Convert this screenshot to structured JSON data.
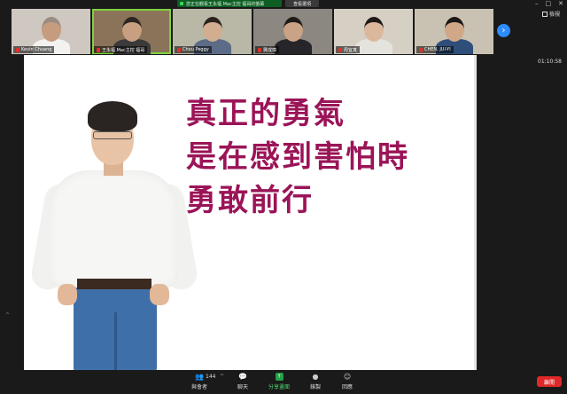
{
  "top_banner": {
    "share_text": "您正在觀看王永福 Mac主控 福哥的螢幕",
    "view_options_label": "查看選項"
  },
  "gallery": {
    "participants": [
      {
        "name": "Kevin Chuang",
        "active": false,
        "bg": "#cfc8c0",
        "skin": "#c69c7f",
        "hair": "#9a8c80",
        "shirt": "#f2f2f0"
      },
      {
        "name": "王永福 Mac主控 福哥",
        "active": true,
        "bg": "#8a7358",
        "skin": "#c8a081",
        "hair": "#2c2622",
        "shirt": "#3a3a3a"
      },
      {
        "name": "Chou Peggy",
        "active": false,
        "bg": "#b9b7a6",
        "skin": "#d2ae90",
        "hair": "#2b2220",
        "shirt": "#5c6b86"
      },
      {
        "name": "龔成璋",
        "active": false,
        "bg": "#8c8780",
        "skin": "#caa386",
        "hair": "#1f1b18",
        "shirt": "#26252a"
      },
      {
        "name": "周宜真",
        "active": false,
        "bg": "#d6cfc4",
        "skin": "#dbb89c",
        "hair": "#1f1a18",
        "shirt": "#e5e3de"
      },
      {
        "name": "CHEN, JUI-YI",
        "active": false,
        "bg": "#c9c2b2",
        "skin": "#d0a888",
        "hair": "#1c1816",
        "shirt": "#2f4f7a"
      }
    ],
    "speaker_view_label": "檢視",
    "timer": "01:10:58"
  },
  "slide": {
    "quote_lines": [
      "真正的勇氣",
      "是在感到害怕時",
      "勇敢前行"
    ],
    "quote_color": "#9b1457"
  },
  "toolbar": {
    "participants_count": "144",
    "participants_label": "與會者",
    "chat_label": "聊天",
    "share_label": "分享畫面",
    "record_label": "錄製",
    "reactions_label": "回應",
    "end_label": "離開"
  },
  "colors": {
    "share_green": "#24a148",
    "active_outline": "#7fd33c",
    "end_red": "#e02828",
    "next_blue": "#2d8cff"
  }
}
